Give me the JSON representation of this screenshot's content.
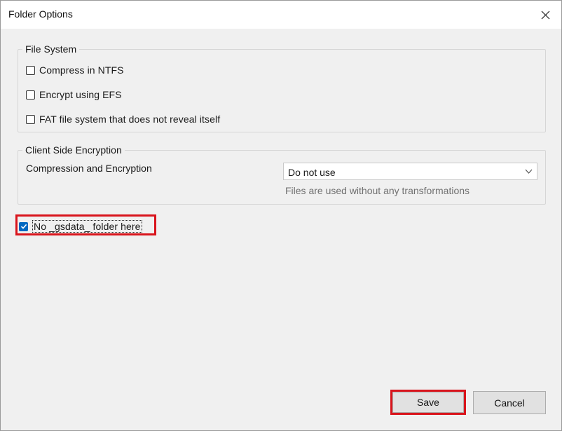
{
  "window": {
    "title": "Folder Options"
  },
  "file_system": {
    "legend": "File System",
    "options": [
      {
        "label": "Compress in NTFS",
        "checked": false
      },
      {
        "label": "Encrypt using EFS",
        "checked": false
      },
      {
        "label": "FAT file system that does not reveal itself",
        "checked": false
      }
    ]
  },
  "client_side_encryption": {
    "legend": "Client Side Encryption",
    "field_label": "Compression and Encryption",
    "selected_value": "Do not use",
    "hint": "Files are used without any transformations"
  },
  "gsdata_option": {
    "label": "No _gsdata_ folder here",
    "checked": true
  },
  "buttons": {
    "save": "Save",
    "cancel": "Cancel"
  },
  "colors": {
    "accent": "#0067c0",
    "highlight": "#d9141c"
  }
}
